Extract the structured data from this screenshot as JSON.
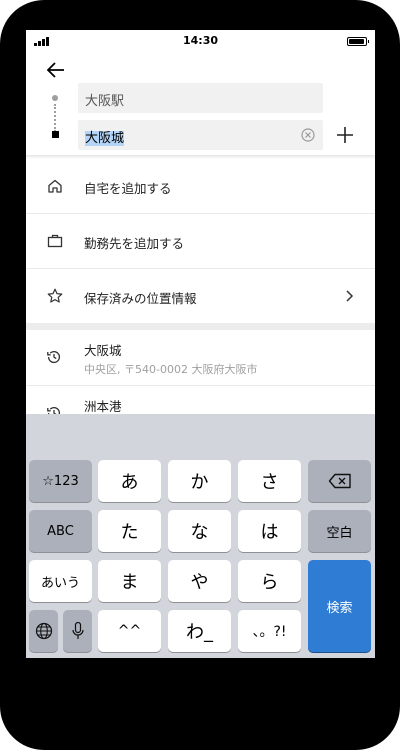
{
  "status_bar": {
    "time": "14:30"
  },
  "route": {
    "origin_value": "大阪駅",
    "destination_value": "大阪城"
  },
  "menu": [
    {
      "label": "自宅を追加する",
      "icon": "home-icon"
    },
    {
      "label": "勤務先を追加する",
      "icon": "briefcase-icon"
    },
    {
      "label": "保存済みの位置情報",
      "icon": "star-icon"
    }
  ],
  "recent": [
    {
      "title": "大阪城",
      "subtitle": "中央区, 〒540-0002 大阪府大阪市",
      "icon": "history-icon"
    },
    {
      "title": "洲本港",
      "subtitle": "",
      "icon": "history-icon"
    }
  ],
  "keyboard": {
    "row1": [
      "☆123",
      "あ",
      "か",
      "さ"
    ],
    "row2": [
      "ABC",
      "た",
      "な",
      "は",
      "空白"
    ],
    "row3": [
      "あいう",
      "ま",
      "や",
      "ら"
    ],
    "row4": [
      "^^",
      "わ_",
      "、。?!"
    ],
    "search_label": "検索"
  },
  "colors": {
    "search_key": "#2f7cd4",
    "keyboard_bg": "#d3d5dc",
    "selection": "#b3d4f6"
  }
}
